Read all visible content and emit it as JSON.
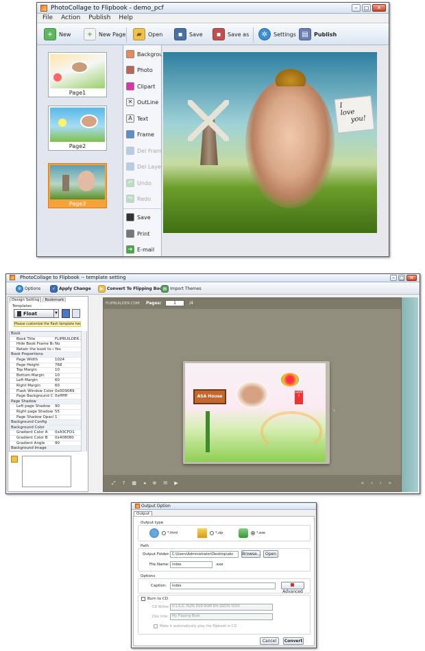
{
  "w1": {
    "title": "PhotoCollage to Flipbook - demo_pcf",
    "menus": [
      "File",
      "Action",
      "Publish",
      "Help"
    ],
    "toolbar": [
      "New",
      "New Page",
      "Open",
      "Save",
      "Save as",
      "Settings",
      "Publish"
    ],
    "pages": [
      "Page1",
      "Page2",
      "Page3"
    ],
    "tools": [
      "Background",
      "Photo",
      "Clipart",
      "OutLine",
      "Text",
      "Frame",
      "Del Frame",
      "Del Layer",
      "Undo",
      "Redo",
      "Save",
      "Print",
      "E-mail"
    ],
    "sticky_line1": "I",
    "sticky_line2": "love",
    "sticky_line3": "you!"
  },
  "w2": {
    "title": "PhotoCollage to Flipbook -- template setting",
    "toolbar": [
      "Options",
      "Apply Change",
      "Convert To Flipping Book",
      "Import Themes"
    ],
    "tabs": [
      "Design Setting",
      "Bookmark"
    ],
    "templates_label": "Templates",
    "template_name": "Float",
    "customize_note": "Please customize the flash template here",
    "props": [
      {
        "k": "Book",
        "v": "",
        "group": true
      },
      {
        "k": "Book Title",
        "v": "FLIPBUILDER..."
      },
      {
        "k": "Hide Book Frame Bar",
        "v": "No"
      },
      {
        "k": "Retain the book to center",
        "v": "Yes"
      },
      {
        "k": "Book Proportions",
        "v": "",
        "group": true
      },
      {
        "k": "Page Width",
        "v": "1024"
      },
      {
        "k": "Page Height",
        "v": "768"
      },
      {
        "k": "Top Margin",
        "v": "10"
      },
      {
        "k": "Bottom Margin",
        "v": "10"
      },
      {
        "k": "Left Margin",
        "v": "60"
      },
      {
        "k": "Right Margin",
        "v": "60"
      },
      {
        "k": "Flash Window Color",
        "v": "0x0D9089"
      },
      {
        "k": "Page Background Color",
        "v": "0xffffff"
      },
      {
        "k": "Page Shadow",
        "v": "",
        "group": true
      },
      {
        "k": "Left page Shadow",
        "v": "90"
      },
      {
        "k": "Right page Shadow",
        "v": "55"
      },
      {
        "k": "Page Shadow Opacity",
        "v": "1"
      },
      {
        "k": "Background Config",
        "v": "",
        "group": true
      },
      {
        "k": "Background Color",
        "v": "",
        "group": true
      },
      {
        "k": "Gradient Color A",
        "v": "0xA3CFD1"
      },
      {
        "k": "Gradient Color B",
        "v": "0x408080"
      },
      {
        "k": "Gradient Angle",
        "v": "90"
      },
      {
        "k": "Background Image",
        "v": "",
        "group": true
      }
    ],
    "brand": "FLIPBUILDER.COM",
    "pages_label": "Pages:",
    "page_current": "1",
    "page_total": "/4",
    "house_text": "ASA House",
    "happy_text": "HAPPY"
  },
  "w3": {
    "title": "Output Option",
    "tab": "Output",
    "output_type_label": "Output type",
    "types": [
      "*.html",
      "*.zip",
      "*.exe"
    ],
    "path_label": "Path",
    "output_folder_label": "Output Folder:",
    "output_folder": "C:\\Users\\Administrator\\Desktop\\abc",
    "browse": "Browse...",
    "open": "Open",
    "file_name_label": "File Name:",
    "file_name": "index",
    "file_ext": ".exe",
    "options_label": "Options",
    "caption_label": "Caption:",
    "caption": "index",
    "advanced": "Advanced",
    "burn_label": "Burn to CD",
    "cd_writer_label": "CD Writer:",
    "cd_writer": "0:1:0,G: PLDS   DVD-ROM DH-16D3S  YD15",
    "disc_title_label": "Disc title:",
    "disc_title": "My Flipping Book",
    "autoplay": "Make it automatically play the flipbook in CD",
    "cancel": "Cancel",
    "convert": "Convert"
  }
}
